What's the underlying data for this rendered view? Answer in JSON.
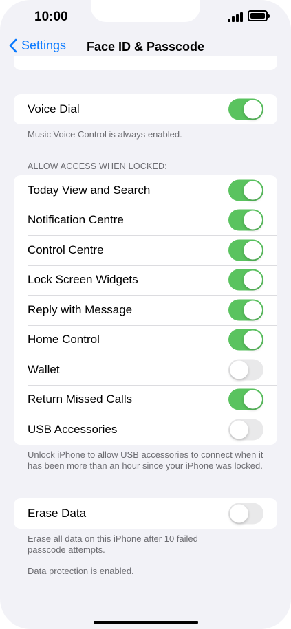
{
  "status_bar": {
    "time": "10:00"
  },
  "nav": {
    "back_label": "Settings",
    "title": "Face ID & Passcode"
  },
  "voice_dial": {
    "label": "Voice Dial",
    "enabled": true,
    "footer": "Music Voice Control is always enabled."
  },
  "allow_access": {
    "header": "ALLOW ACCESS WHEN LOCKED:",
    "items": [
      {
        "label": "Today View and Search",
        "enabled": true
      },
      {
        "label": "Notification Centre",
        "enabled": true
      },
      {
        "label": "Control Centre",
        "enabled": true
      },
      {
        "label": "Lock Screen Widgets",
        "enabled": true
      },
      {
        "label": "Reply with Message",
        "enabled": true
      },
      {
        "label": "Home Control",
        "enabled": true
      },
      {
        "label": "Wallet",
        "enabled": false
      },
      {
        "label": "Return Missed Calls",
        "enabled": true
      },
      {
        "label": "USB Accessories",
        "enabled": false
      }
    ],
    "footer": "Unlock iPhone to allow USB accessories to connect when it has been more than an hour since your iPhone was locked."
  },
  "erase_data": {
    "label": "Erase Data",
    "enabled": false,
    "footer": "Erase all data on this iPhone after 10 failed passcode attempts.",
    "protection_note": "Data protection is enabled."
  },
  "colors": {
    "accent": "#0a7aff",
    "toggle_on": "#5ac35f",
    "toggle_off": "#e9e9ea",
    "background": "#f2f2f7"
  },
  "icons": {
    "back": "chevron-left-icon",
    "signal": "cellular-signal-icon",
    "battery": "battery-icon"
  }
}
